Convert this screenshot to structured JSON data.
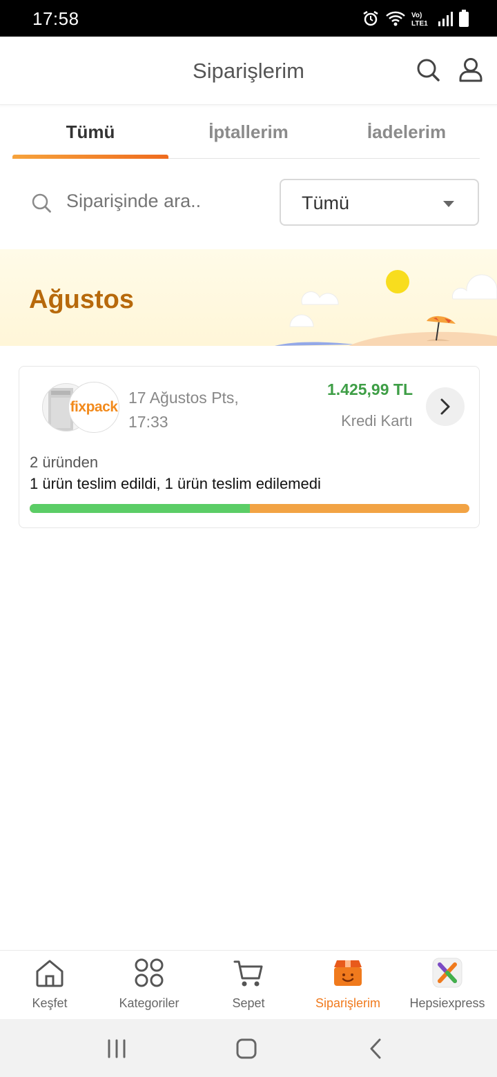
{
  "status_bar": {
    "time": "17:58",
    "network_label": "Vo) LTE1"
  },
  "header": {
    "title": "Siparişlerim"
  },
  "tabs": [
    {
      "label": "Tümü",
      "active": true
    },
    {
      "label": "İptallerim",
      "active": false
    },
    {
      "label": "İadelerim",
      "active": false
    }
  ],
  "search": {
    "placeholder": "Siparişinde ara.."
  },
  "filter": {
    "selected": "Tümü"
  },
  "month_section": {
    "title": "Ağustos"
  },
  "order": {
    "brand": "fixpack",
    "date": "17 Ağustos Pts, 17:33",
    "price": "1.425,99 TL",
    "payment_method": "Kredi Kartı",
    "item_count_text": "2 üründen",
    "delivery_status": "1 ürün teslim edildi, 1 ürün teslim edilemedi",
    "delivered_fraction": 0.5
  },
  "bottom_nav": [
    {
      "label": "Keşfet",
      "icon": "home-icon",
      "active": false
    },
    {
      "label": "Kategoriler",
      "icon": "categories-icon",
      "active": false
    },
    {
      "label": "Sepet",
      "icon": "cart-icon",
      "active": false
    },
    {
      "label": "Siparişlerim",
      "icon": "orders-box-icon",
      "active": true
    },
    {
      "label": "Hepsiexpress",
      "icon": "hepsiexpress-icon",
      "active": false
    }
  ],
  "colors": {
    "accent": "#f07a1d",
    "price_green": "#3e9e46",
    "delivered_green": "#5bcd66",
    "undelivered_orange": "#f2a344",
    "month_title": "#b7690b"
  }
}
